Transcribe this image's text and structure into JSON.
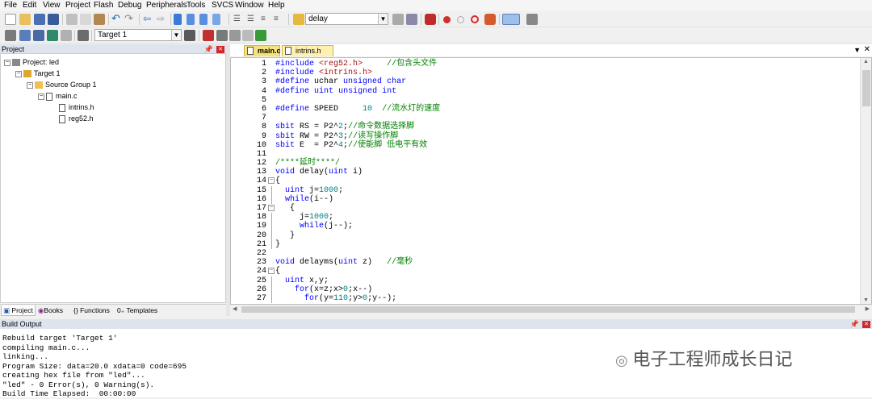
{
  "menu": [
    "File",
    "Edit",
    "View",
    "Project",
    "Flash",
    "Debug",
    "Peripherals",
    "Tools",
    "SVCS",
    "Window",
    "Help"
  ],
  "toolbar1": {
    "find_value": "delay"
  },
  "toolbar2": {
    "target_value": "Target 1"
  },
  "project_pane": {
    "title": "Project",
    "tree": [
      "Project: led",
      "Target 1",
      "Source Group 1",
      "main.c",
      "intrins.h",
      "reg52.h"
    ],
    "tabs": [
      "Project",
      "Books",
      "Functions",
      "Templates"
    ]
  },
  "editor": {
    "tabs": [
      "main.c",
      "intrins.h"
    ],
    "lines": [
      {
        "n": "1",
        "t": "#include <reg52.h>     //包含头文件"
      },
      {
        "n": "2",
        "t": "#include <intrins.h>"
      },
      {
        "n": "3",
        "t": "#define uchar unsigned char"
      },
      {
        "n": "4",
        "t": "#define uint unsigned int"
      },
      {
        "n": "5",
        "t": ""
      },
      {
        "n": "6",
        "t": "#define SPEED     10  //流水灯的速度"
      },
      {
        "n": "7",
        "t": ""
      },
      {
        "n": "8",
        "t": "sbit RS = P2^2;//命令数据选择脚"
      },
      {
        "n": "9",
        "t": "sbit RW = P2^3;//读写操作脚"
      },
      {
        "n": "10",
        "t": "sbit E  = P2^4;//使能脚 低电平有效"
      },
      {
        "n": "11",
        "t": ""
      },
      {
        "n": "12",
        "t": "/****延时****/"
      },
      {
        "n": "13",
        "t": "void delay(uint i)"
      },
      {
        "n": "14",
        "t": "{"
      },
      {
        "n": "15",
        "t": "  uint j=1000;"
      },
      {
        "n": "16",
        "t": "  while(i--)"
      },
      {
        "n": "17",
        "t": "   {"
      },
      {
        "n": "18",
        "t": "     j=1000;"
      },
      {
        "n": "19",
        "t": "     while(j--);"
      },
      {
        "n": "20",
        "t": "   }"
      },
      {
        "n": "21",
        "t": "}"
      },
      {
        "n": "22",
        "t": ""
      },
      {
        "n": "23",
        "t": "void delayms(uint z)   //毫秒"
      },
      {
        "n": "24",
        "t": "{"
      },
      {
        "n": "25",
        "t": "  uint x,y;"
      },
      {
        "n": "26",
        "t": "    for(x=z;x>0;x--)"
      },
      {
        "n": "27",
        "t": "      for(y=110;y>0;y--);"
      }
    ]
  },
  "build_output": {
    "title": "Build Output",
    "lines": [
      "Rebuild target 'Target 1'",
      "compiling main.c...",
      "linking...",
      "Program Size: data=20.0 xdata=0 code=695",
      "creating hex file from \"led\"...",
      "\"led\" - 0 Error(s), 0 Warning(s).",
      "Build Time Elapsed:  00:00:00"
    ]
  },
  "watermark": "电子工程师成长日记"
}
